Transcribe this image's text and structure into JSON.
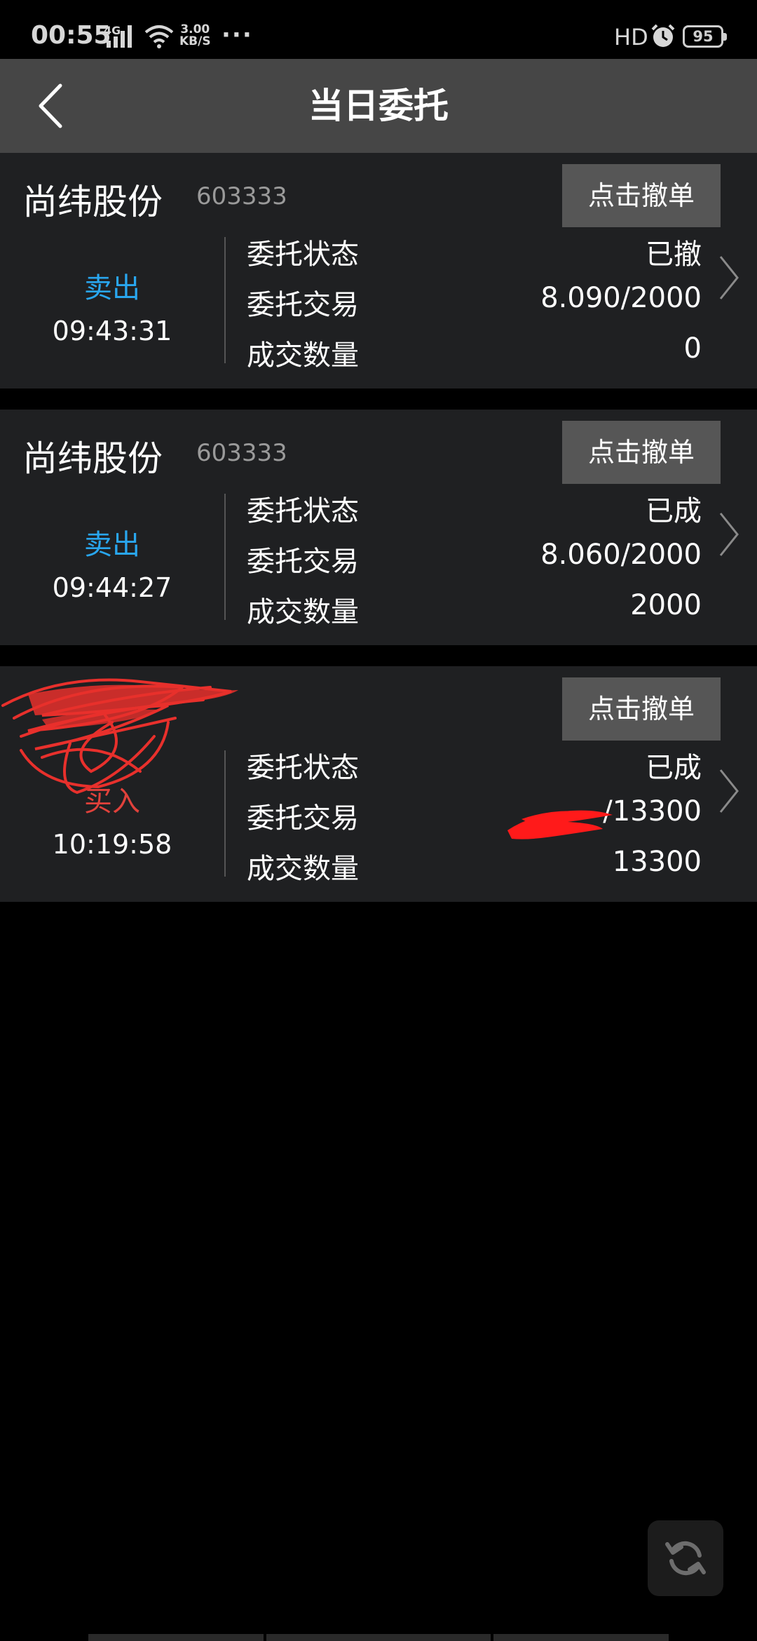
{
  "status_bar": {
    "time": "00:55",
    "network": "4G",
    "speed_value": "3.00",
    "speed_unit": "KB/S",
    "more": "···",
    "hd": "HD",
    "battery": "95"
  },
  "header": {
    "title": "当日委托"
  },
  "labels": {
    "status": "委托状态",
    "trade": "委托交易",
    "filled": "成交数量",
    "cancel": "点击撤单"
  },
  "orders": [
    {
      "name": "尚纬股份",
      "code": "603333",
      "side": "卖出",
      "time": "09:43:31",
      "status": "已撤",
      "trade": "8.090/2000",
      "filled": "0"
    },
    {
      "name": "尚纬股份",
      "code": "603333",
      "side": "卖出",
      "time": "09:44:27",
      "status": "已成",
      "trade": "8.060/2000",
      "filled": "2000"
    },
    {
      "name": "",
      "code": "",
      "side": "买入",
      "time": "10:19:58",
      "status": "已成",
      "trade": "/13300",
      "filled": "13300"
    }
  ],
  "colors": {
    "sell": "#29a6ee",
    "buy": "#e0413b",
    "header_bg": "#464646",
    "card_bg": "#1f2022",
    "button_bg": "#565656"
  },
  "icons": {
    "back": "chevron-left-icon",
    "detail": "chevron-right-icon",
    "refresh": "refresh-icon"
  }
}
